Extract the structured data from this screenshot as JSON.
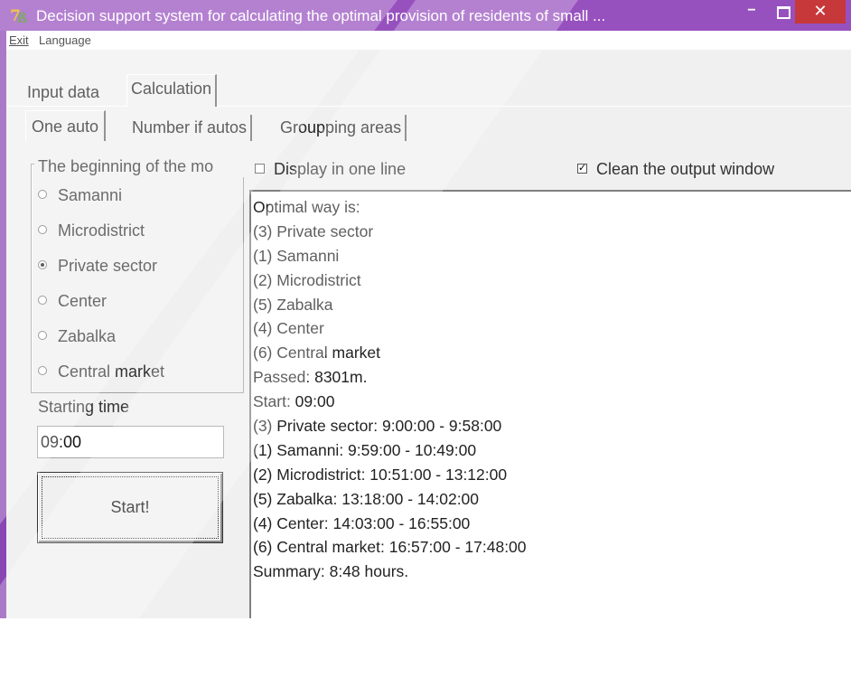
{
  "window": {
    "title": "Decision support system for calculating the optimal provision of residents of small ...",
    "minimize": "−",
    "close": "✕",
    "titlebar_color": "#9751bf",
    "close_color": "#c7383a"
  },
  "menu": {
    "exit": "Exit",
    "language": "Language"
  },
  "tabs": {
    "outer": [
      "Input data",
      "Calculation"
    ],
    "inner": [
      "One auto",
      "Number if autos",
      "Groupping areas"
    ]
  },
  "start_group": {
    "legend": "The beginning of the mo",
    "options": [
      "Samanni",
      "Microdistrict",
      "Private sector",
      "Center",
      "Zabalka",
      "Central market"
    ],
    "selected": "Private sector"
  },
  "starting_time": {
    "label": "Starting time",
    "value": "09:00"
  },
  "start_button": "Start!",
  "options": {
    "display_one_line": "Display in one line",
    "display_one_line_checked": false,
    "clean_output": "Clean the output window",
    "clean_output_checked": true
  },
  "output": {
    "lines": [
      "Optimal way is:",
      "(3) Private sector",
      "(1) Samanni",
      "(2) Microdistrict",
      "(5) Zabalka",
      "(4) Center",
      "(6) Central market",
      "Passed: 8301m.",
      "Start: 09:00",
      "(3) Private sector: 9:00:00 - 9:58:00",
      "(1) Samanni: 9:59:00 - 10:49:00",
      "(2) Microdistrict: 10:51:00 - 13:12:00",
      "(5) Zabalka: 13:18:00 - 14:02:00",
      "(4) Center: 14:03:00 - 16:55:00",
      "(6) Central market: 16:57:00 - 17:48:00",
      "Summary: 8:48 hours."
    ]
  }
}
